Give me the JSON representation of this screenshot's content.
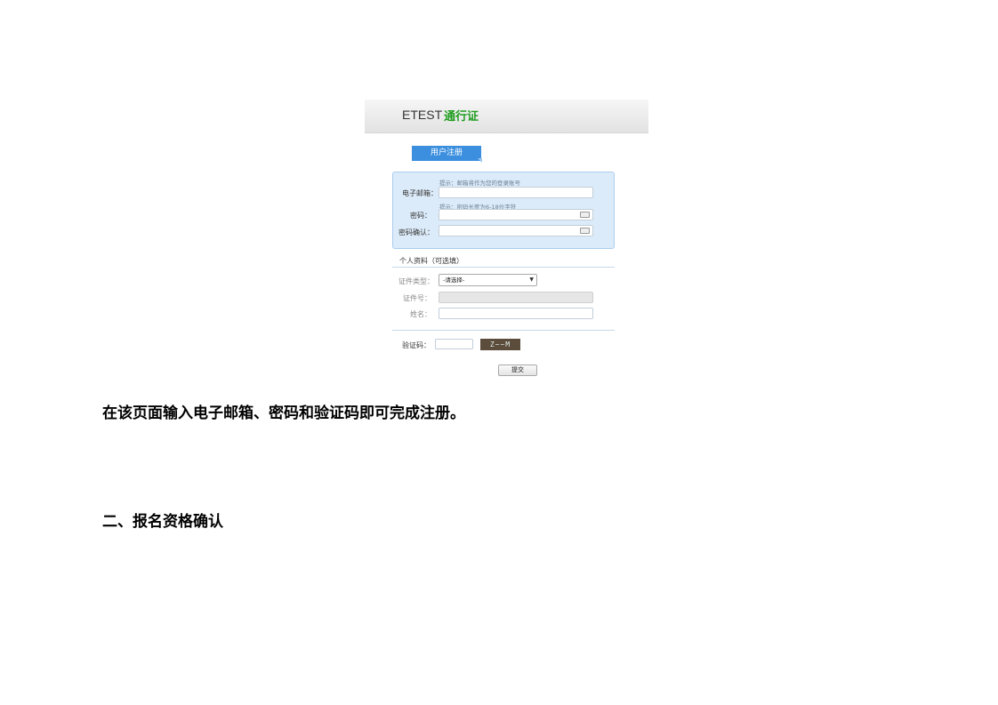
{
  "screenshot": {
    "brand": {
      "name": "ETEST",
      "suffix": "通行证"
    },
    "tab": "用户注册",
    "account": {
      "email": {
        "hint": "提示：邮箱将作为您的登录账号",
        "label": "电子邮箱：",
        "value": ""
      },
      "password": {
        "hint": "提示：密码长度为6-18位字符",
        "label": "密码：",
        "value": ""
      },
      "confirm": {
        "label": "密码确认：",
        "value": ""
      }
    },
    "profile": {
      "title": "个人资料（可选填）",
      "id_type": {
        "label": "证件类型：",
        "selected": "-请选择-"
      },
      "id_number": {
        "label": "证件号：",
        "value": ""
      },
      "name": {
        "label": "姓名：",
        "value": ""
      }
    },
    "captcha": {
      "label": "验证码：",
      "value": "",
      "image_text": "Z~~M"
    },
    "submit": "提交"
  },
  "document": {
    "paragraph": "在该页面输入电子邮箱、密码和验证码即可完成注册。",
    "heading": "二、报名资格确认"
  }
}
